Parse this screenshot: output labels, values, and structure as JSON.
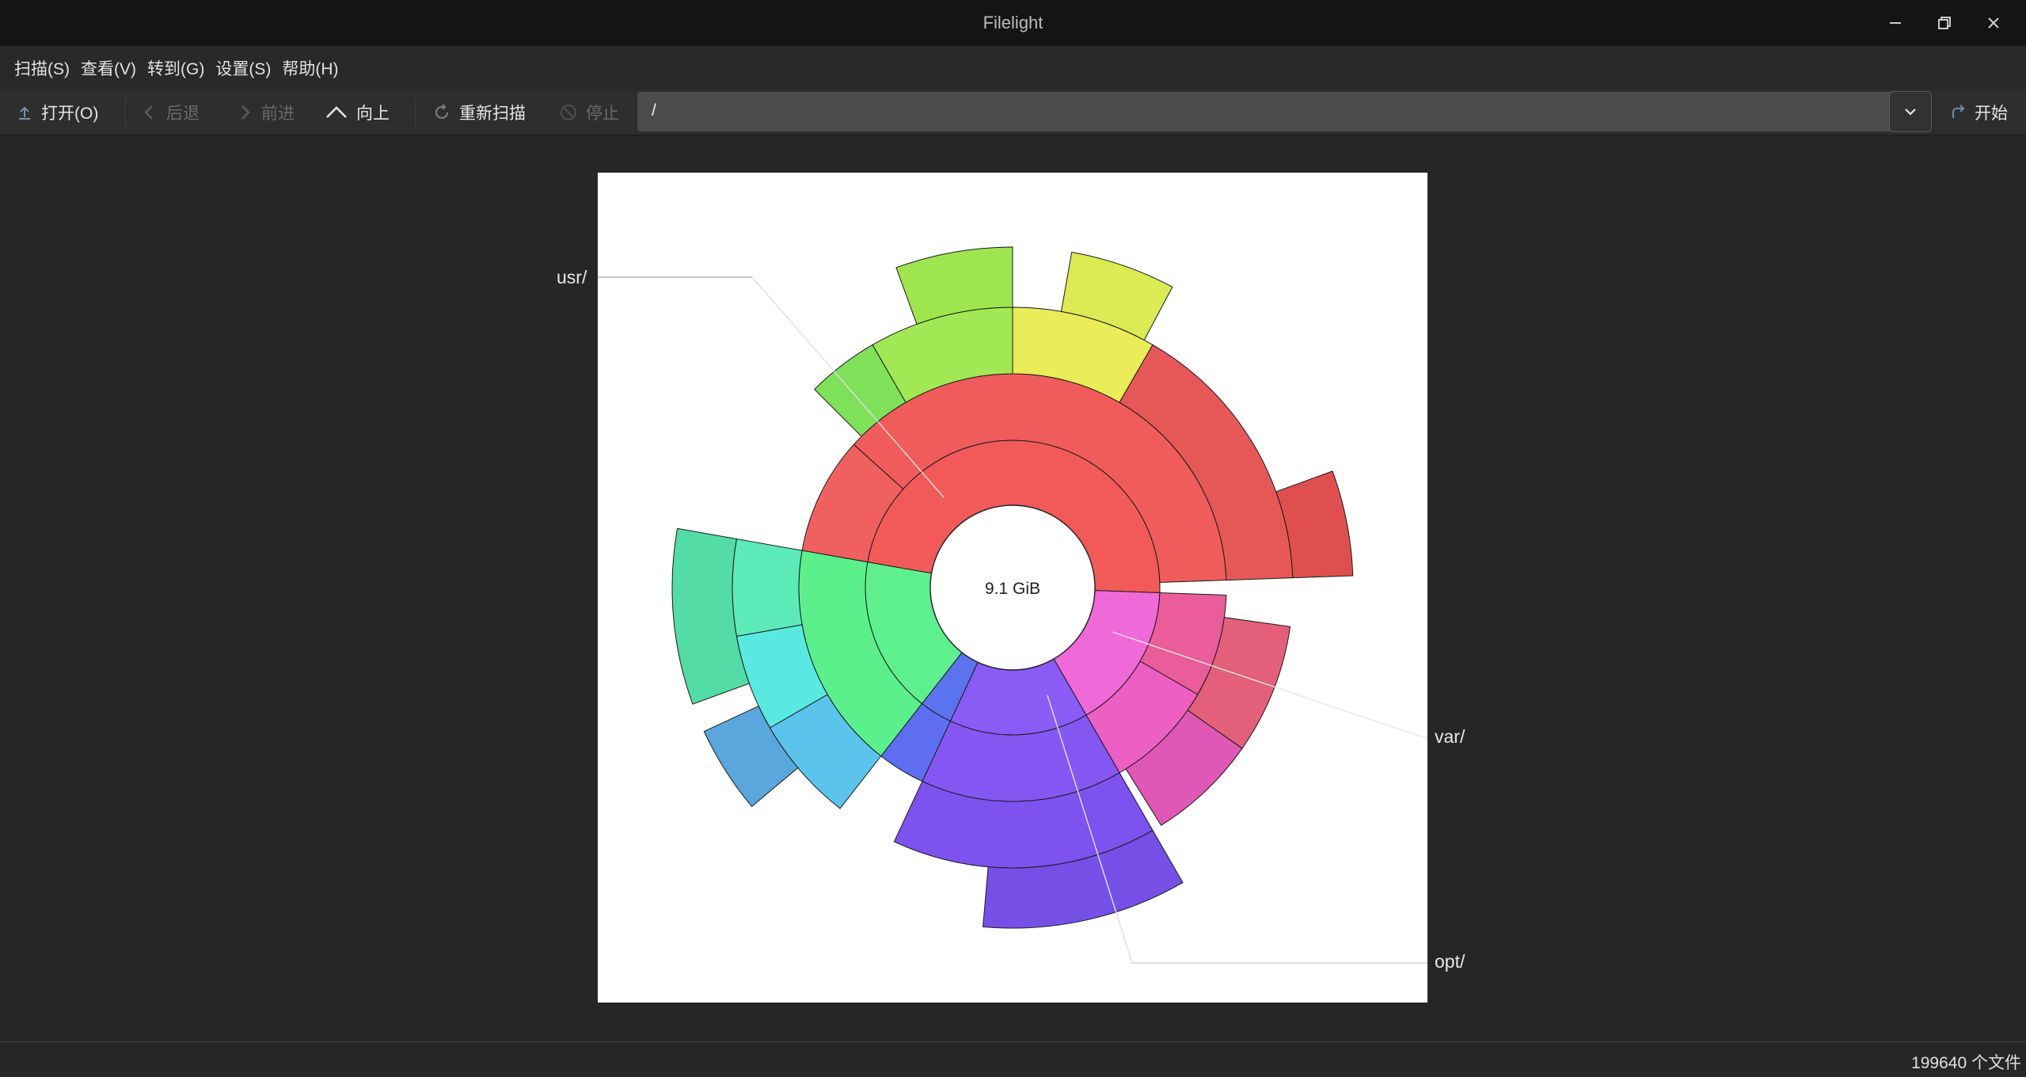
{
  "window": {
    "title": "Filelight"
  },
  "menu": [
    "扫描(S)",
    "查看(V)",
    "转到(G)",
    "设置(S)",
    "帮助(H)"
  ],
  "toolbar": {
    "open": "打开(O)",
    "back": "后退",
    "forward": "前进",
    "up": "向上",
    "rescan": "重新扫描",
    "stop": "停止",
    "go": "开始"
  },
  "path": {
    "value": "/"
  },
  "chart": {
    "center_label": "9.1 GiB",
    "labels": {
      "usr": "usr/",
      "var": "var/",
      "opt": "opt/"
    }
  },
  "status": {
    "file_count": "199640 个文件"
  },
  "chart_data": {
    "type": "sunburst",
    "total": "9.1 GiB",
    "labeled_segments": [
      "usr/",
      "var/",
      "opt/"
    ],
    "top_level_colors": {
      "usr": "#f25a5a",
      "var": "#f069d8",
      "opt": "#8a5bf5",
      "other_green": "#5ef08f",
      "blue": "#5b73ee"
    }
  }
}
